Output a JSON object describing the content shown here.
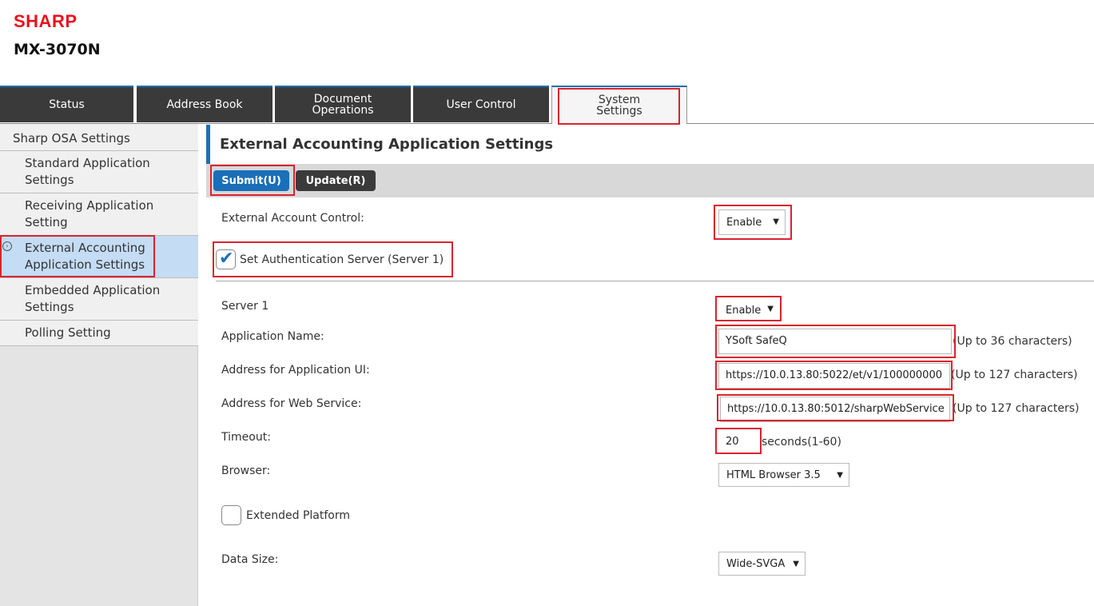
{
  "header": {
    "brand": "SHARP",
    "model": "MX-3070N"
  },
  "tabs": [
    {
      "label": "Status"
    },
    {
      "label": "Address Book"
    },
    {
      "label": "Document Operations"
    },
    {
      "label": "User Control"
    },
    {
      "label": "System Settings"
    }
  ],
  "sidebar": {
    "items": [
      {
        "label": "Sharp OSA Settings"
      },
      {
        "label": "Standard Application Settings"
      },
      {
        "label": "Receiving Application Setting"
      },
      {
        "label": "External Accounting Application Settings"
      },
      {
        "label": "Embedded Application Settings"
      },
      {
        "label": "Polling Setting"
      }
    ]
  },
  "main": {
    "title": "External Accounting Application Settings",
    "submit_label": "Submit(U)",
    "update_label": "Update(R)",
    "account_control": {
      "label": "External Account Control:",
      "value": "Enable"
    },
    "auth_server": {
      "label": "Set Authentication Server (Server 1)",
      "checked": true
    },
    "server1": {
      "label": "Server 1",
      "value": "Enable"
    },
    "app_name": {
      "label": "Application Name:",
      "value": "YSoft SafeQ",
      "hint": "(Up to 36 characters)"
    },
    "app_ui": {
      "label": "Address for Application UI:",
      "value": "https://10.0.13.80:5022/et/v1/100000000",
      "hint": "(Up to 127 characters)"
    },
    "web_service": {
      "label": "Address for Web Service:",
      "value": "https://10.0.13.80:5012/sharpWebService",
      "hint": "(Up to 127 characters)"
    },
    "timeout": {
      "label": "Timeout:",
      "value": "20",
      "hint": "seconds(1-60)"
    },
    "browser": {
      "label": "Browser:",
      "value": "HTML Browser 3.5"
    },
    "extended_platform": {
      "label": "Extended Platform",
      "checked": false
    },
    "data_size": {
      "label": "Data Size:",
      "value": "Wide-SVGA"
    }
  },
  "colors": {
    "accent": "#1a6fb8",
    "highlight": "#d9232e",
    "brand": "#e8101f",
    "tab_dark": "#3a3a3a"
  }
}
